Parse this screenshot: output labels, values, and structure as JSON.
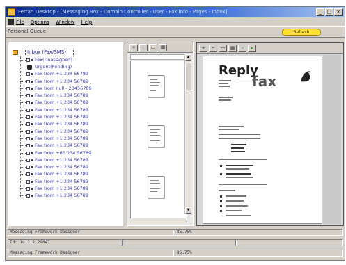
{
  "window": {
    "title": "Ferrari Desktop - [Messaging Box - Domain Controller - User - Fax Info - Pages - Inbox]",
    "controls": [
      "_",
      "□",
      "×"
    ]
  },
  "menu": [
    "File",
    "Options",
    "Window",
    "Help"
  ],
  "header": {
    "section_title": "Personal Queue",
    "yellow_button": "Refresh"
  },
  "tree": {
    "root_label": "Inbox (Fax/SMS)",
    "items": [
      {
        "icon": "fax-icon",
        "label": "Fax(Unassigned)"
      },
      {
        "icon": "phone-icon",
        "label": "Urgent(Pending)"
      },
      {
        "icon": "fax-icon",
        "label": "Fax from +1 234 56789"
      },
      {
        "icon": "fax-icon",
        "label": "Fax from +1 234 56789"
      },
      {
        "icon": "fax-icon",
        "label": "Fax from null - 23456789"
      },
      {
        "icon": "fax-icon",
        "label": "Fax from +1 234 56789"
      },
      {
        "icon": "fax-icon",
        "label": "Fax from +1 234 56789"
      },
      {
        "icon": "fax-icon",
        "label": "Fax from +1 234 56789"
      },
      {
        "icon": "fax-icon",
        "label": "Fax from +1 234 56789"
      },
      {
        "icon": "fax-icon",
        "label": "Fax from +1 234 56789"
      },
      {
        "icon": "fax-icon",
        "label": "Fax from +1 234 56789"
      },
      {
        "icon": "fax-icon",
        "label": "Fax from +1 234 56789"
      },
      {
        "icon": "fax-icon",
        "label": "Fax from +1 234 56789"
      },
      {
        "icon": "fax-icon",
        "label": "Fax from +61 234 56789"
      },
      {
        "icon": "fax-icon",
        "label": "Fax from +1 234 56789"
      },
      {
        "icon": "fax-icon",
        "label": "Fax from +1 234 56789"
      },
      {
        "icon": "fax-icon",
        "label": "Fax from +1 234 56789"
      },
      {
        "icon": "fax-icon",
        "label": "Fax from +1 234 56789"
      },
      {
        "icon": "fax-icon",
        "label": "Fax from +1 234 56789"
      },
      {
        "icon": "fax-icon",
        "label": "Fax from +1 234 56789"
      }
    ]
  },
  "thumb_toolbar": [
    "zoom-in-icon",
    "zoom-out-icon",
    "fit-page-icon",
    "grid-icon"
  ],
  "preview_toolbar": [
    "zoom-in-icon",
    "zoom-out-icon",
    "fit-page-icon",
    "grid-icon",
    "back-icon",
    "forward-icon"
  ],
  "document": {
    "heading_1": "Reply",
    "heading_2": "fax"
  },
  "status": [
    {
      "left": "Messaging Framework Designer",
      "right": "85.75%"
    },
    {
      "left": "Id: 1u.1.2.29847",
      "right": ""
    },
    {
      "left": "Messaging Framework Designer",
      "right": "85.75%"
    }
  ]
}
